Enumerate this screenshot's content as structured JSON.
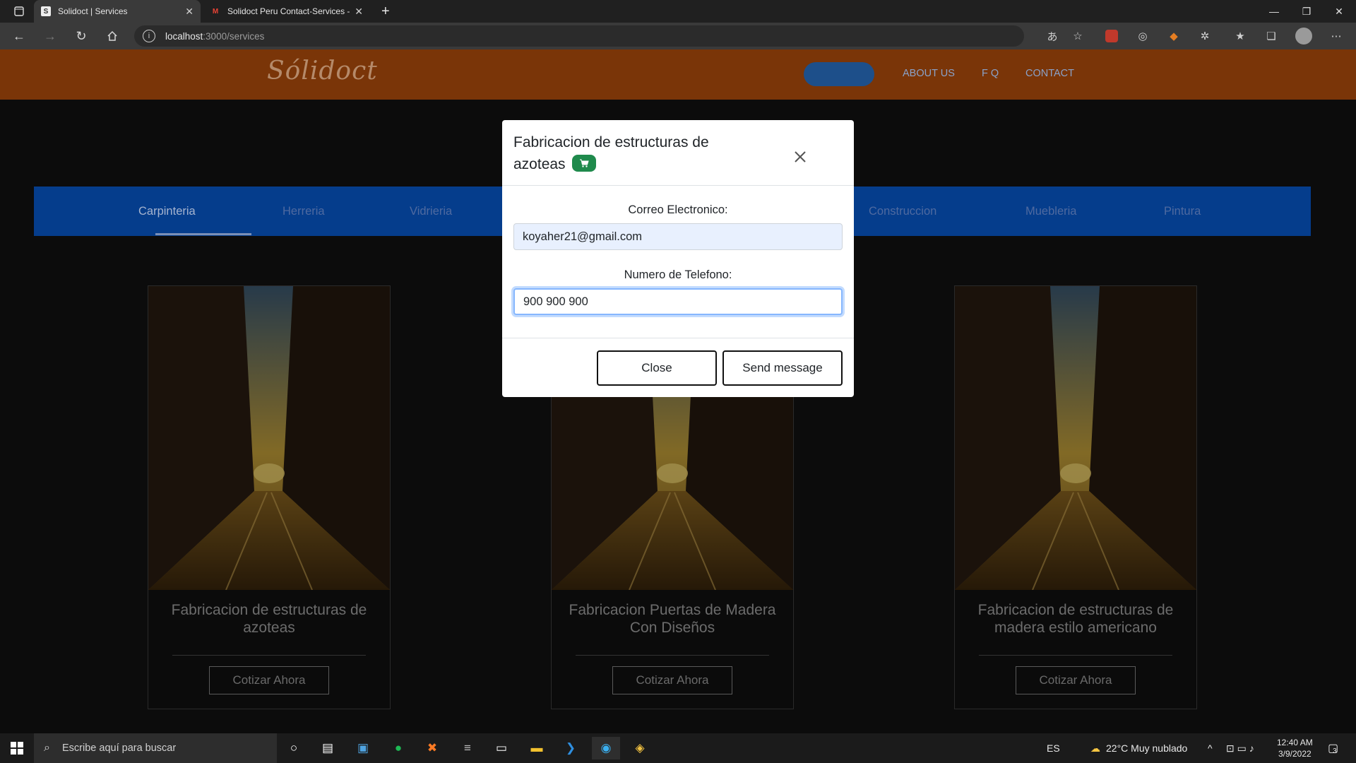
{
  "browser": {
    "tabs": [
      {
        "title": "Solidoct | Services",
        "active": true
      },
      {
        "title": "Solidoct Peru Contact-Services -",
        "active": false
      }
    ],
    "url_host": "localhost",
    "url_path": ":3000/services"
  },
  "site": {
    "logo": "Sólidoct",
    "nav": [
      "ABOUT US",
      "F Q",
      "CONTACT"
    ]
  },
  "service_tabs": [
    "Carpinteria",
    "Herreria",
    "Vidrieria",
    "Construccion",
    "Muebleria",
    "Pintura"
  ],
  "cards": [
    {
      "title": "Fabricacion de estructuras de azoteas",
      "button": "Cotizar Ahora"
    },
    {
      "title": "Fabricacion Puertas de Madera Con Diseños",
      "button": "Cotizar Ahora"
    },
    {
      "title": "Fabricacion de estructuras de madera estilo americano",
      "button": "Cotizar Ahora"
    }
  ],
  "modal": {
    "title": "Fabricacion de estructuras de azoteas",
    "email_label": "Correo Electronico:",
    "email_value": "koyaher21@gmail.com",
    "phone_label": "Numero de Telefono:",
    "phone_value": "900 900 900",
    "close_label": "Close",
    "send_label": "Send message"
  },
  "taskbar": {
    "search_placeholder": "Escribe aquí para buscar",
    "language": "ES",
    "weather": "22°C  Muy nublado",
    "time": "12:40 AM",
    "date": "3/9/2022",
    "notifications": "3"
  },
  "colors": {
    "header": "#7a3508",
    "service_bar": "#053d8c",
    "badge": "#1f8a4c"
  }
}
